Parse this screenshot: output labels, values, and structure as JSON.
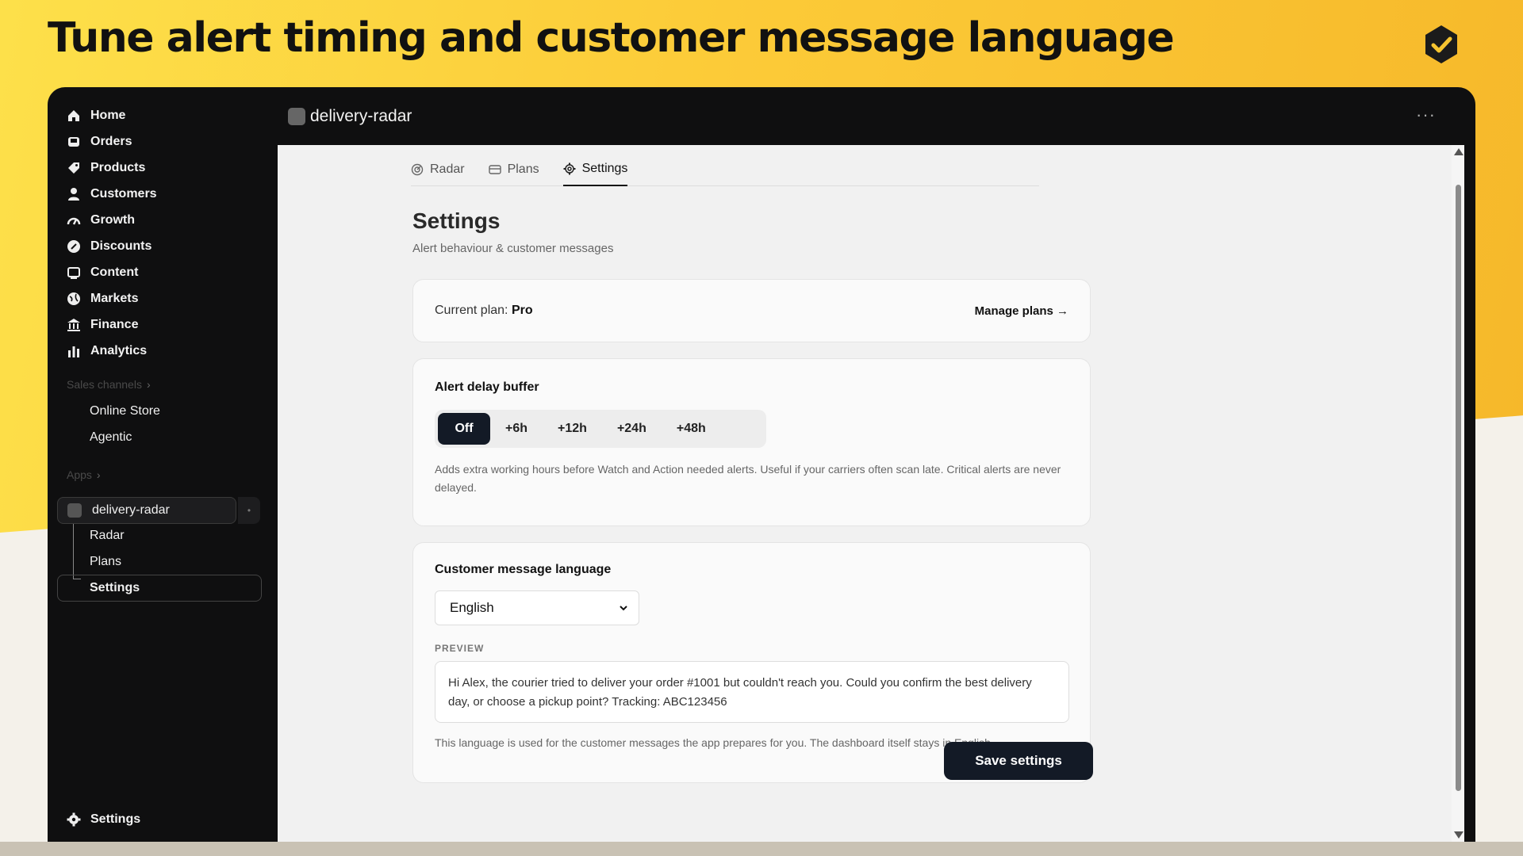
{
  "headline": "Tune alert timing and customer message language",
  "sidebar": {
    "items": [
      {
        "label": "Home",
        "icon": "home-icon"
      },
      {
        "label": "Orders",
        "icon": "inbox-icon"
      },
      {
        "label": "Products",
        "icon": "tag-icon"
      },
      {
        "label": "Customers",
        "icon": "person-icon"
      },
      {
        "label": "Growth",
        "icon": "gauge-icon"
      },
      {
        "label": "Discounts",
        "icon": "discount-icon"
      },
      {
        "label": "Content",
        "icon": "image-icon"
      },
      {
        "label": "Markets",
        "icon": "globe-icon"
      },
      {
        "label": "Finance",
        "icon": "bank-icon"
      },
      {
        "label": "Analytics",
        "icon": "bar-chart-icon"
      }
    ],
    "sales_channels_label": "Sales channels",
    "sales_channels": [
      "Online Store",
      "Agentic"
    ],
    "apps_label": "Apps",
    "app_name": "delivery-radar",
    "app_subitems": [
      "Radar",
      "Plans",
      "Settings"
    ],
    "bottom_settings": "Settings"
  },
  "topbar": {
    "app_title": "delivery-radar",
    "more": "···"
  },
  "tabs": [
    {
      "label": "Radar",
      "icon": "radar-icon",
      "active": false
    },
    {
      "label": "Plans",
      "icon": "card-icon",
      "active": false
    },
    {
      "label": "Settings",
      "icon": "gear-icon",
      "active": true
    }
  ],
  "page": {
    "title": "Settings",
    "subtitle": "Alert behaviour & customer messages"
  },
  "plan_card": {
    "label": "Current plan:",
    "plan": "Pro",
    "manage_link": "Manage plans →"
  },
  "delay_card": {
    "heading": "Alert delay buffer",
    "options": [
      "Off",
      "+6h",
      "+12h",
      "+24h",
      "+48h"
    ],
    "selected": "Off",
    "help": "Adds extra working hours before Watch and Action needed alerts. Useful if your carriers often scan late. Critical alerts are never delayed."
  },
  "language_card": {
    "heading": "Customer message language",
    "selected_language": "English",
    "preview_label": "PREVIEW",
    "preview_text": "Hi Alex, the courier tried to deliver your order #1001 but couldn't reach you. Could you confirm the best delivery day, or choose a pickup point? Tracking: ABC123456",
    "help": "This language is used for the customer messages the app prepares for you. The dashboard itself stays in English."
  },
  "save_button": "Save settings",
  "colors": {
    "accent_dark": "#131a26",
    "background_yellow": "#fccb38",
    "window_dark": "#0f0f10"
  }
}
